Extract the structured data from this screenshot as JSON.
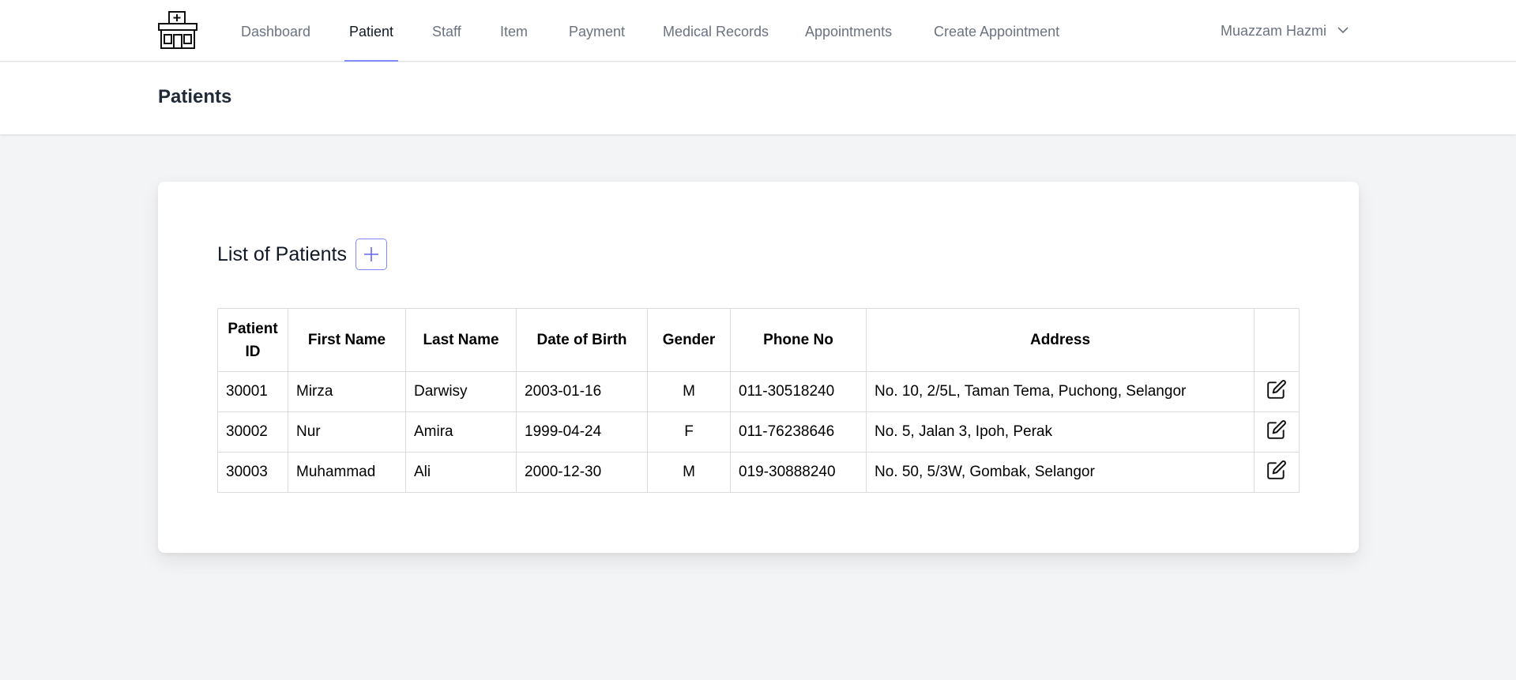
{
  "nav": {
    "items": [
      {
        "label": "Dashboard"
      },
      {
        "label": "Patient"
      },
      {
        "label": "Staff"
      },
      {
        "label": "Item"
      },
      {
        "label": "Payment"
      },
      {
        "label": "Medical Records"
      },
      {
        "label": "Appointments"
      },
      {
        "label": "Create Appointment"
      }
    ],
    "active": "Patient",
    "logo_icon": "hospital-icon"
  },
  "user": {
    "name": "Muazzam Hazmi",
    "dropdown_icon": "chevron-down-icon"
  },
  "page": {
    "title": "Patients"
  },
  "card": {
    "title": "List of Patients",
    "add_icon": "plus-icon"
  },
  "table": {
    "headers": [
      "Patient ID",
      "First Name",
      "Last Name",
      "Date of Birth",
      "Gender",
      "Phone No",
      "Address",
      ""
    ],
    "rows": [
      {
        "id": "30001",
        "first_name": "Mirza",
        "last_name": "Darwisy",
        "dob": "2003-01-16",
        "gender": "M",
        "phone": "011-30518240",
        "address": "No. 10, 2/5L, Taman Tema, Puchong, Selangor"
      },
      {
        "id": "30002",
        "first_name": "Nur",
        "last_name": "Amira",
        "dob": "1999-04-24",
        "gender": "F",
        "phone": "011-76238646",
        "address": "No. 5, Jalan 3, Ipoh, Perak"
      },
      {
        "id": "30003",
        "first_name": "Muhammad",
        "last_name": "Ali",
        "dob": "2000-12-30",
        "gender": "M",
        "phone": "019-30888240",
        "address": "No. 50, 5/3W, Gombak, Selangor"
      }
    ],
    "row_action_icon": "edit-icon"
  },
  "colors": {
    "accent": "#818cf8",
    "nav_text": "#6b7280",
    "background": "#f3f4f6"
  }
}
